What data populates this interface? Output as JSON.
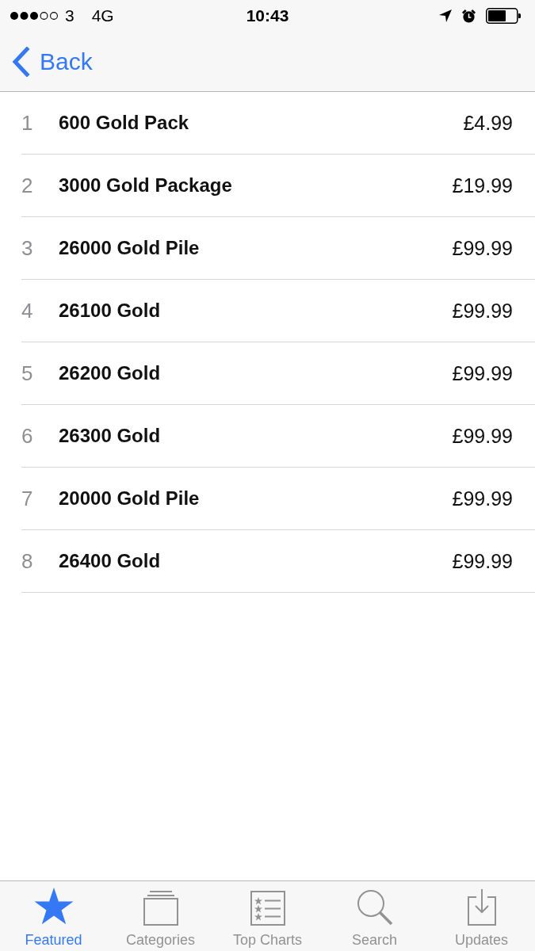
{
  "status_bar": {
    "carrier": "3",
    "network": "4G",
    "time": "10:43"
  },
  "navigation": {
    "back_label": "Back"
  },
  "items": [
    {
      "rank": "1",
      "name": "600 Gold Pack",
      "price": "£4.99"
    },
    {
      "rank": "2",
      "name": "3000 Gold Package",
      "price": "£19.99"
    },
    {
      "rank": "3",
      "name": "26000 Gold Pile",
      "price": "£99.99"
    },
    {
      "rank": "4",
      "name": "26100 Gold",
      "price": "£99.99"
    },
    {
      "rank": "5",
      "name": "26200 Gold",
      "price": "£99.99"
    },
    {
      "rank": "6",
      "name": "26300 Gold",
      "price": "£99.99"
    },
    {
      "rank": "7",
      "name": "20000 Gold Pile",
      "price": "£99.99"
    },
    {
      "rank": "8",
      "name": "26400 Gold",
      "price": "£99.99"
    }
  ],
  "tabs": [
    {
      "label": "Featured",
      "kind": "star",
      "selected": true
    },
    {
      "label": "Categories",
      "kind": "stack",
      "selected": false
    },
    {
      "label": "Top Charts",
      "kind": "chart",
      "selected": false
    },
    {
      "label": "Search",
      "kind": "search",
      "selected": false
    },
    {
      "label": "Updates",
      "kind": "download",
      "selected": false
    }
  ]
}
